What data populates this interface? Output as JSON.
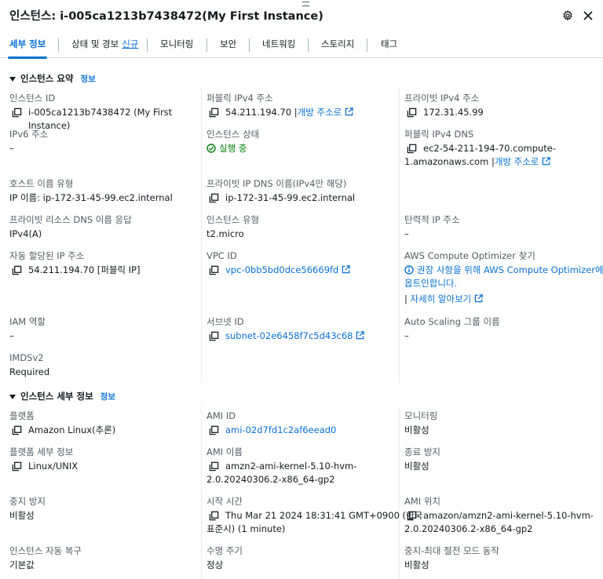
{
  "header": {
    "title": "인스턴스: i-005ca1213b7438472(My First Instance)"
  },
  "tabs": [
    {
      "label": "세부 정보"
    },
    {
      "label": "상태 및 경보",
      "badge": "신규"
    },
    {
      "label": "모니터링"
    },
    {
      "label": "보안"
    },
    {
      "label": "네트워킹"
    },
    {
      "label": "스토리지"
    },
    {
      "label": "태그"
    }
  ],
  "summary": {
    "heading": "인스턴스 요약",
    "info": "정보",
    "instance_id": {
      "label": "인스턴스 ID",
      "value": "i-005ca1213b7438472 (My First Instance)"
    },
    "public_ipv4": {
      "label": "퍼블릭 IPv4 주소",
      "value": "54.211.194.70 |",
      "link": "개방 주소로"
    },
    "private_ipv4": {
      "label": "프라이빗 IPv4 주소",
      "value": "172.31.45.99"
    },
    "ipv6": {
      "label": "IPv6 주소",
      "value": "–"
    },
    "instance_state": {
      "label": "인스턴스 상태",
      "value": "실행 중"
    },
    "public_dns": {
      "label": "퍼블릭 IPv4 DNS",
      "value_line1": "ec2-54-211-194-70.compute-",
      "value_line2": "1.amazonaws.com |",
      "link": "개방 주소로"
    },
    "hostname_type": {
      "label": "호스트 이름 유형",
      "value": "IP 이름: ip-172-31-45-99.ec2.internal"
    },
    "private_dns": {
      "label": "프라이빗 IP DNS 이름(IPv4만 해당)",
      "value": "ip-172-31-45-99.ec2.internal"
    },
    "resource_dns": {
      "label": "프라이빗 리소스 DNS 이름 응답",
      "value": "IPv4(A)"
    },
    "instance_type": {
      "label": "인스턴스 유형",
      "value": "t2.micro"
    },
    "elastic_ip": {
      "label": "탄력적 IP 주소",
      "value": "–"
    },
    "auto_ip": {
      "label": "자동 할당된 IP 주소",
      "value": "54.211.194.70 [퍼블릭 IP]"
    },
    "vpc_id": {
      "label": "VPC ID",
      "value": "vpc-0bb5bd0dce56669fd"
    },
    "optimizer": {
      "label": "AWS Compute Optimizer 찾기",
      "line1": "권장 사항을 위해 AWS Compute Optimizer에",
      "line2": "옵트인합니다.",
      "learn_prefix": "|",
      "learn": "자세히 알아보기"
    },
    "iam_role": {
      "label": "IAM 역할",
      "value": "–"
    },
    "subnet_id": {
      "label": "서브넷 ID",
      "value": "subnet-02e6458f7c5d43c68"
    },
    "asg_name": {
      "label": "Auto Scaling 그룹 이름",
      "value": "–"
    },
    "imdsv2": {
      "label": "IMDSv2",
      "value": "Required"
    }
  },
  "details": {
    "heading": "인스턴스 세부 정보",
    "info": "정보",
    "platform": {
      "label": "플랫폼",
      "value": "Amazon Linux(추론)"
    },
    "ami_id": {
      "label": "AMI ID",
      "value": "ami-02d7fd1c2af6eead0"
    },
    "monitoring": {
      "label": "모니터링",
      "value": "비활성"
    },
    "platform_detail": {
      "label": "플랫폼 세부 정보",
      "value": "Linux/UNIX"
    },
    "ami_name": {
      "label": "AMI 이름",
      "value_line1": "amzn2-ami-kernel-5.10-hvm-",
      "value_line2": "2.0.20240306.2-x86_64-gp2"
    },
    "term_protect": {
      "label": "종료 방지",
      "value": "비활성"
    },
    "stop_protect": {
      "label": "중지 방지",
      "value": "비활성"
    },
    "launch_time": {
      "label": "시작 시간",
      "value_line1": "Thu Mar 21 2024 18:31:41 GMT+0900 (한국",
      "value_line2": "표준시) (1 minute)"
    },
    "ami_location": {
      "label": "AMI 위치",
      "value_line1": "amazon/amzn2-ami-kernel-5.10-hvm-",
      "value_line2": "2.0.20240306.2-x86_64-gp2"
    },
    "auto_recovery": {
      "label": "인스턴스 자동 복구",
      "value": "기본값"
    },
    "lifecycle": {
      "label": "수명 주기",
      "value": "정상"
    },
    "stop_hibernate": {
      "label": "중지-최대 절전 모드 동작",
      "value": "비활성"
    }
  }
}
